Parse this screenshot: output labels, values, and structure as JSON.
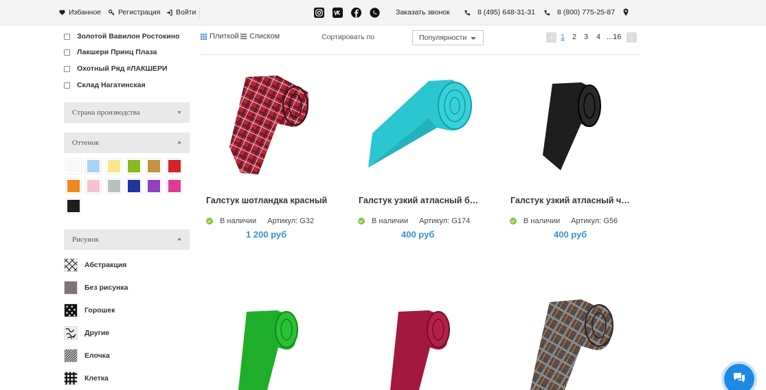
{
  "topbar": {
    "favorites": "Избанное",
    "register": "Регистрация",
    "login": "Войти",
    "callback": "Заказать звонок",
    "phone1": "8 (495) 648-31-31",
    "phone2": "8 (800) 775-25-87"
  },
  "sidebar": {
    "stores": [
      "Золотой Вавилон Ростокино",
      "Лакшери Принц Плаза",
      "Охотный Ряд #ЛАКШЕРИ",
      "Склад Нагатинская"
    ],
    "country_filter": "Страна производства",
    "shade_filter": "Оттенок",
    "shades": [
      "#f7f7f7",
      "#a9d3f5",
      "#fbe68b",
      "#8ab81f",
      "#c6913f",
      "#d4212a",
      "#f08a1f",
      "#f7c2ce",
      "#b7c1be",
      "#1f35a0",
      "#8f43c1",
      "#e03a95",
      "#1e1e1e"
    ],
    "pattern_filter": "Рисунок",
    "patterns": [
      "Абстракция",
      "Без рисунка",
      "Горошек",
      "Другие",
      "Елочка",
      "Клетка"
    ]
  },
  "toolbar": {
    "view_tiles": "Плиткой",
    "view_list": "Списком",
    "sort_label": "Сортировать по",
    "sort_value": "Популярности",
    "pages": [
      "1",
      "2",
      "3",
      "4",
      "...16"
    ]
  },
  "products": [
    {
      "name": "Галстук шотландка красный",
      "status": "В наличии",
      "article": "Артикул: G32",
      "price": "1 200 руб",
      "color": "#b8242e"
    },
    {
      "name": "Галстук узкий атласный би…",
      "status": "В наличии",
      "article": "Артикул: G174",
      "price": "400 руб",
      "color": "#2cc6d0"
    },
    {
      "name": "Галстук узкий атласный че…",
      "status": "В наличии",
      "article": "Артикул: G56",
      "price": "400 руб",
      "color": "#1e1e1e"
    },
    {
      "color": "#1fae2a"
    },
    {
      "color": "#a3183f"
    },
    {
      "color": "#555555"
    }
  ]
}
